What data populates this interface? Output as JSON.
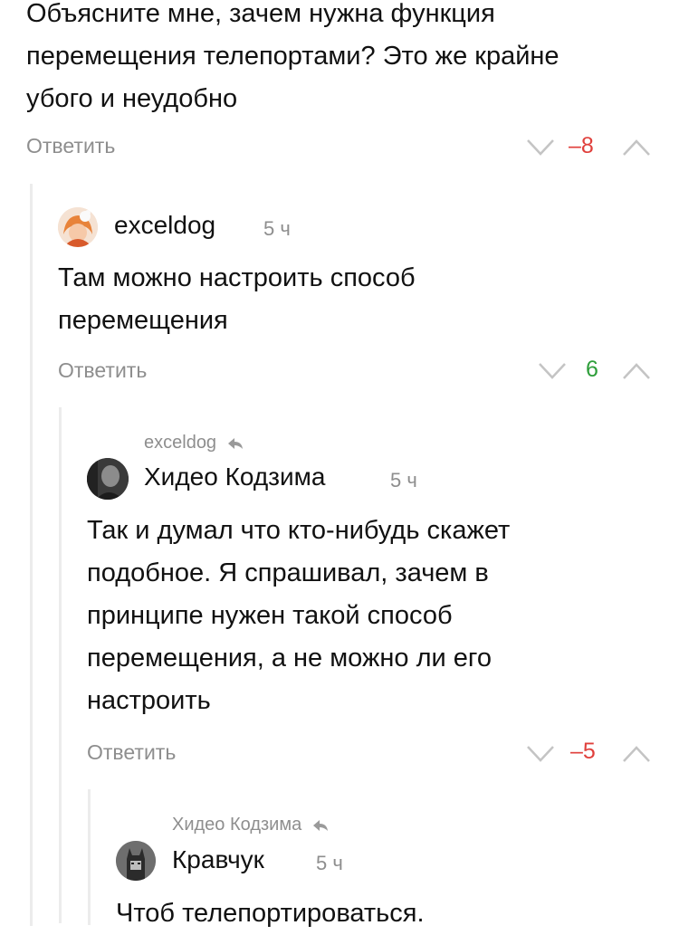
{
  "root_comment": {
    "text_lines": [
      "Объясните мне, зачем нужна функция",
      "перемещения телепортами? Это же крайне",
      "убого и неудобно"
    ],
    "reply_label": "Ответить",
    "score": "–8"
  },
  "comment1": {
    "author": "exceldog",
    "time": "5 ч",
    "text_lines": [
      "Там можно настроить способ",
      "перемещения"
    ],
    "reply_label": "Ответить",
    "score": "6"
  },
  "comment2": {
    "parent_ref": "exceldog",
    "author": "Хидео Кодзима",
    "time": "5 ч",
    "text_lines": [
      "Так и думал что кто-нибудь скажет",
      "подобное. Я спрашивал, зачем в",
      "принципе нужен такой способ",
      "перемещения, а не можно ли его",
      "настроить"
    ],
    "reply_label": "Ответить",
    "score": "–5"
  },
  "comment3": {
    "parent_ref": "Хидео Кодзима",
    "author": "Кравчук",
    "time": "5 ч",
    "text_lines": [
      "Чтоб телепортироваться."
    ]
  },
  "colors": {
    "negative": "#e0403c",
    "positive": "#2e9e3a",
    "muted": "#8e8e8e"
  }
}
